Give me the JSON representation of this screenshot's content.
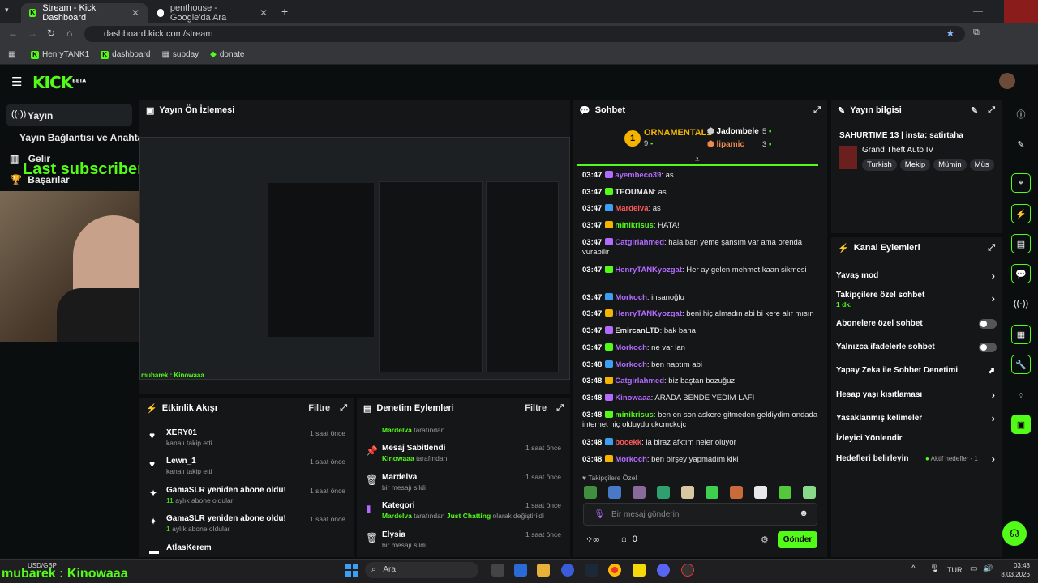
{
  "browser": {
    "tabs": [
      {
        "title": "Stream - Kick Dashboard",
        "active": true
      },
      {
        "title": "penthouse - Google'da Ara",
        "active": false
      }
    ],
    "url": "dashboard.kick.com/stream",
    "bookmarks": [
      "HenryTANK1",
      "dashboard",
      "subday",
      "donate"
    ]
  },
  "brand": {
    "logo": "KICK",
    "beta": "BETA"
  },
  "sidebar": {
    "items": [
      {
        "label": "Yayın",
        "icon": "broadcast-icon"
      },
      {
        "label": "Yayın Bağlantısı ve Anahtarı",
        "icon": ""
      },
      {
        "label": "Gelir",
        "icon": "chart-icon"
      },
      {
        "label": "Başarılar",
        "icon": "trophy-icon"
      }
    ]
  },
  "overlay": {
    "last_subscriber": "Last subscriber : GamaSLR",
    "bottom_text": "mubarek : Kinowaaa",
    "preview_caption": "mubarek : Kinowaaa"
  },
  "preview": {
    "title": "Yayın Ön İzlemesi"
  },
  "activity": {
    "title": "Etkinlik Akışı",
    "filter": "Filtre",
    "rows": [
      {
        "name": "XERY01",
        "sub": "kanalı takip etti",
        "time": "1 saat önce",
        "icon": "heart-icon"
      },
      {
        "name": "Lewn_1",
        "sub": "kanalı takip etti",
        "time": "1 saat önce",
        "icon": "heart-icon"
      },
      {
        "name": "GamaSLR yeniden abone oldu!",
        "sub_num": "11",
        "sub": " aylık abone oldular",
        "time": "1 saat önce",
        "icon": "sparkle-icon"
      },
      {
        "name": "GamaSLR yeniden abone oldu!",
        "sub_num": "1",
        "sub": " aylık abone oldular",
        "time": "1 saat önce",
        "icon": "sparkle-icon"
      },
      {
        "name": "AtlasKerem",
        "sub": "",
        "time": "",
        "icon": "hat-icon"
      }
    ]
  },
  "moderation": {
    "title": "Denetim Eylemleri",
    "filter": "Filtre",
    "top_line": {
      "user": "Mardelva",
      "text": " tarafından"
    },
    "rows": [
      {
        "name": "Mesaj Sabitlendi",
        "user": "Kinowaaa",
        "sub": " tarafından",
        "time": "1 saat önce",
        "icon": "pin-icon"
      },
      {
        "name": "Mardelva",
        "user": "",
        "sub": "bir mesajı sildi",
        "time": "1 saat önce",
        "icon": "trash-icon"
      },
      {
        "name": "Kategori",
        "user": "Mardelva",
        "sub": " tarafından ",
        "highlight": "Just Chatting",
        "sub2": " olarak değiştirildi",
        "time": "1 saat önce",
        "icon": "category-icon"
      },
      {
        "name": "Elysia",
        "user": "",
        "sub": "bir mesajı sildi",
        "time": "1 saat önce",
        "icon": "trash-icon"
      }
    ]
  },
  "chat": {
    "title": "Sohbet",
    "leaderboard": {
      "first": {
        "rank": "1",
        "name": "ORNAMENTAL1",
        "count": "9"
      },
      "second": {
        "name": "Jadombele",
        "count": "5"
      },
      "third": {
        "name": "lipamic",
        "count": "3"
      }
    },
    "messages": [
      {
        "time": "03:47",
        "user": "ayembeco39",
        "text": ": as",
        "color": "#b36bff"
      },
      {
        "time": "03:47",
        "user": "TEOUMAN",
        "text": ": as",
        "color": "#e8e8e8"
      },
      {
        "time": "03:47",
        "user": "Mardelva",
        "text": ": as",
        "color": "#ff5a5a"
      },
      {
        "time": "03:47",
        "user": "minikrisus",
        "text": ": HATA!",
        "color": "#53fc18"
      },
      {
        "time": "03:47",
        "user": "Catgirlahmed",
        "text": ": hala ban yeme şansım var ama orenda vurabilir",
        "color": "#b36bff"
      },
      {
        "time": "03:47",
        "user": "HenryTANKyozgat",
        "text": ": Her ay gelen mehmet kaan sikmesi",
        "color": "#b36bff"
      },
      {
        "time": "03:47",
        "user": "Morkoch",
        "text": ": insanoğlu",
        "color": "#b36bff"
      },
      {
        "time": "03:47",
        "user": "HenryTANKyozgat",
        "text": ": beni hiç almadın abi bi kere alır mısın",
        "color": "#b36bff"
      },
      {
        "time": "03:47",
        "user": "EmircanLTD",
        "text": ": bak bana",
        "color": "#e8e8e8"
      },
      {
        "time": "03:47",
        "user": "Morkoch",
        "text": ": ne var lan",
        "color": "#b36bff"
      },
      {
        "time": "03:48",
        "user": "Morkoch",
        "text": ": ben naptım abi",
        "color": "#b36bff"
      },
      {
        "time": "03:48",
        "user": "Catgirlahmed",
        "text": ": biz baştan bozuğuz",
        "color": "#b36bff"
      },
      {
        "time": "03:48",
        "user": "Kinowaaa",
        "text": ": ARADA BENDE YEDİM LAFI",
        "color": "#b36bff"
      },
      {
        "time": "03:48",
        "user": "minikrisus",
        "text": ": ben en son askere gitmeden geldiydim ondada internet hiç olduydu ckcmckcjc",
        "color": "#53fc18"
      },
      {
        "time": "03:48",
        "user": "bocekk",
        "text": ": la biraz afktım neler oluyor",
        "color": "#ff5a5a"
      },
      {
        "time": "03:48",
        "user": "Morkoch",
        "text": ": ben birşey yapmadım kiki",
        "color": "#b36bff"
      }
    ],
    "emote_section": "Takipçilere Özel",
    "input_placeholder": "Bir mesaj gönderin",
    "viewer_count": "0",
    "send_label": "Gönder"
  },
  "stream_info": {
    "title": "Yayın bilgisi",
    "stream_title": "SAHURTIME 13 | insta: satirtaha",
    "category": "Grand Theft Auto IV",
    "tags": [
      "Turkish",
      "Mekip",
      "Mümin",
      "Müs"
    ]
  },
  "channel_actions": {
    "title": "Kanal Eylemleri",
    "rows": [
      {
        "label": "Yavaş mod",
        "control": "chevron"
      },
      {
        "label": "Takipçilere özel sohbet",
        "sub": "1 dk.",
        "control": "chevron"
      },
      {
        "label": "Abonelere özel sohbet",
        "control": "toggle"
      },
      {
        "label": "Yalnızca ifadelerle sohbet",
        "control": "toggle"
      },
      {
        "label": "Yapay Zeka ile Sohbet Denetimi",
        "control": "external"
      },
      {
        "label": "Hesap yaşı kısıtlaması",
        "control": "chevron"
      },
      {
        "label": "Yasaklanmış kelimeler",
        "control": "chevron"
      },
      {
        "label": "İzleyici Yönlendir",
        "control": "none"
      },
      {
        "label": "Hedefleri belirleyin",
        "status": "Aktif hedefler - 1",
        "control": "chevron"
      }
    ]
  },
  "taskbar": {
    "weather": "USD/GBP",
    "search": "Ara",
    "lang": "TUR",
    "time": "03:48",
    "date": "8.03.2026"
  },
  "colors": {
    "accent": "#53fc18",
    "panel": "#141618",
    "bg": "#0b0e0f"
  }
}
